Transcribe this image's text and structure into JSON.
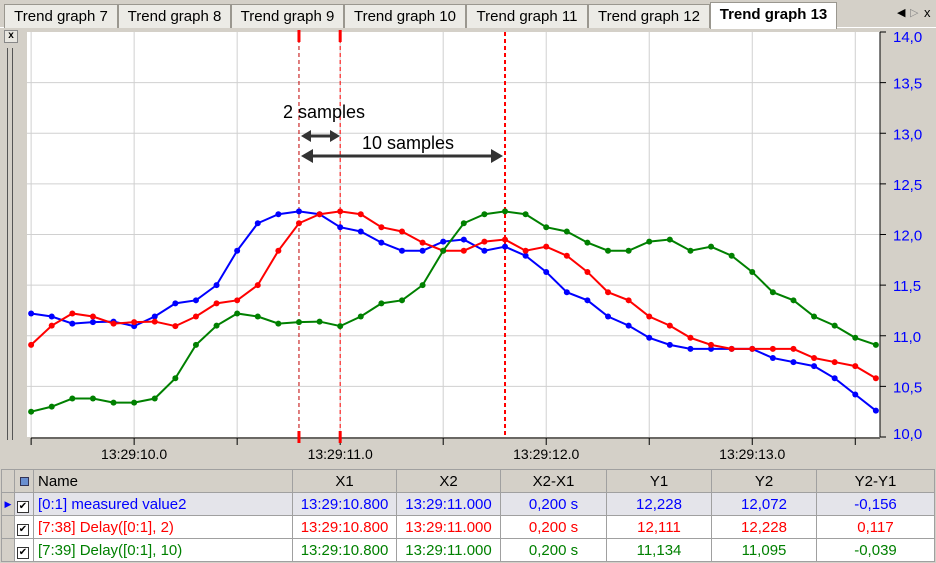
{
  "tabs": [
    "Trend graph 7",
    "Trend graph 8",
    "Trend graph 9",
    "Trend graph 10",
    "Trend graph 11",
    "Trend graph 12",
    "Trend graph 13"
  ],
  "active_tab": 6,
  "tab_nav": {
    "prev": "◀",
    "next": "▷",
    "close": "x"
  },
  "close_label": "x",
  "annotations": {
    "a": "2 samples",
    "b": "10 samples"
  },
  "chart_data": {
    "type": "line",
    "x_start": 9.5,
    "x_step": 0.1,
    "xlim": [
      9.48,
      13.62
    ],
    "ylim": [
      10.0,
      14.0
    ],
    "x_ticks": [
      10.0,
      11.0,
      12.0,
      13.0
    ],
    "x_tick_labels": [
      "13:29:10.0",
      "13:29:11.0",
      "13:29:12.0",
      "13:29:13.0"
    ],
    "y_ticks": [
      10.0,
      10.5,
      11.0,
      11.5,
      12.0,
      12.5,
      13.0,
      13.5,
      14.0
    ],
    "y_tick_labels": [
      "10,0",
      "10,5",
      "11,0",
      "11,5",
      "12,0",
      "12,5",
      "13,0",
      "13,5",
      "14,0"
    ],
    "grid": true,
    "cursors": {
      "x1": 10.8,
      "x2": 11.0,
      "marker": 11.8
    },
    "series": [
      {
        "name": "[0:1] measured value2",
        "color": "#0000ff",
        "values": [
          11.22,
          11.19,
          11.12,
          11.134,
          11.14,
          11.095,
          11.19,
          11.32,
          11.35,
          11.5,
          11.84,
          12.111,
          12.2,
          12.228,
          12.2,
          12.072,
          12.03,
          11.92,
          11.84,
          11.84,
          11.93,
          11.95,
          11.84,
          11.88,
          11.79,
          11.63,
          11.43,
          11.35,
          11.19,
          11.1,
          10.98,
          10.91,
          10.87,
          10.87,
          10.87,
          10.87,
          10.78,
          10.74,
          10.7,
          10.58,
          10.42,
          10.26
        ]
      },
      {
        "name": "[7:38] Delay([0:1], 2)",
        "color": "#ff0000",
        "values": [
          10.91,
          11.1,
          11.22,
          11.19,
          11.12,
          11.134,
          11.14,
          11.095,
          11.19,
          11.32,
          11.35,
          11.5,
          11.84,
          12.111,
          12.2,
          12.228,
          12.2,
          12.072,
          12.03,
          11.92,
          11.84,
          11.84,
          11.93,
          11.95,
          11.84,
          11.88,
          11.79,
          11.63,
          11.43,
          11.35,
          11.19,
          11.1,
          10.98,
          10.91,
          10.87,
          10.87,
          10.87,
          10.87,
          10.78,
          10.74,
          10.7,
          10.58
        ]
      },
      {
        "name": "[7:39] Delay([0:1], 10)",
        "color": "#008000",
        "values": [
          10.25,
          10.3,
          10.38,
          10.38,
          10.34,
          10.34,
          10.38,
          10.58,
          10.91,
          11.1,
          11.22,
          11.19,
          11.12,
          11.134,
          11.14,
          11.095,
          11.19,
          11.32,
          11.35,
          11.5,
          11.84,
          12.111,
          12.2,
          12.228,
          12.2,
          12.072,
          12.03,
          11.92,
          11.84,
          11.84,
          11.93,
          11.95,
          11.84,
          11.88,
          11.79,
          11.63,
          11.43,
          11.35,
          11.19,
          11.1,
          10.98,
          10.91
        ]
      }
    ]
  },
  "table": {
    "headers": [
      "Name",
      "X1",
      "X2",
      "X2-X1",
      "Y1",
      "Y2",
      "Y2-Y1"
    ],
    "rows": [
      {
        "color": "#0000ff",
        "cells": [
          "[0:1] measured value2",
          "13:29:10.800",
          "13:29:11.000",
          "0,200 s",
          "12,228",
          "12,072",
          "-0,156"
        ]
      },
      {
        "color": "#ff0000",
        "cells": [
          "[7:38] Delay([0:1], 2)",
          "13:29:10.800",
          "13:29:11.000",
          "0,200 s",
          "12,111",
          "12,228",
          "0,117"
        ]
      },
      {
        "color": "#008000",
        "cells": [
          "[7:39] Delay([0:1], 10)",
          "13:29:10.800",
          "13:29:11.000",
          "0,200 s",
          "11,134",
          "11,095",
          "-0,039"
        ]
      }
    ]
  }
}
